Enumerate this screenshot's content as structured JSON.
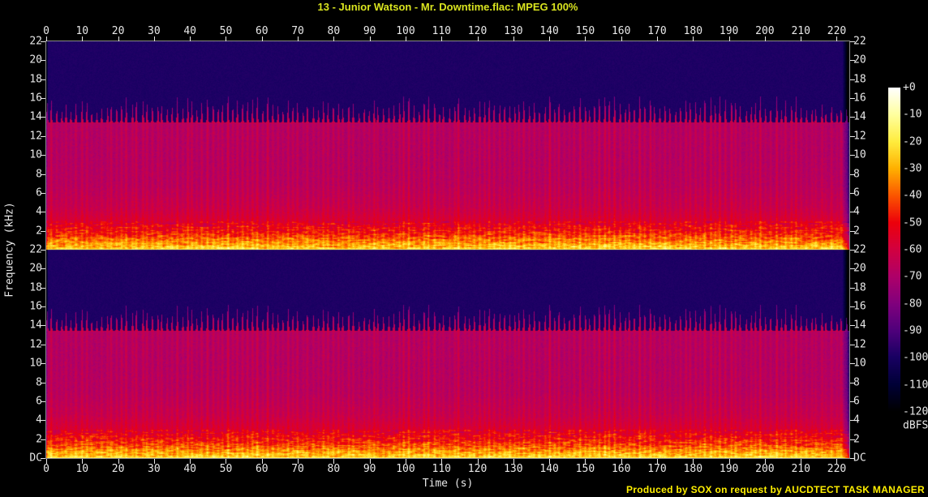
{
  "header": {
    "title": "13 - Junior Watson - Mr. Downtime.flac: MPEG 100%",
    "title_color": "#d9e41f"
  },
  "footer": {
    "credit": "Produced by SOX on request by AUCDTECT TASK MANAGER",
    "color": "#ffef00"
  },
  "ui": {
    "background": "#000000",
    "axis_text_color": "#e8e8e8",
    "plot_border_color": "#8a8a8a"
  },
  "chart_data": {
    "type": "heatmap",
    "subtype": "stereo-audio-spectrogram",
    "title": "13 - Junior Watson - Mr. Downtime.flac: MPEG 100%",
    "xlabel": "Time (s)",
    "ylabel": "Frequency (kHz)",
    "duration_s": 223.5,
    "x_ticks": [
      0,
      10,
      20,
      30,
      40,
      50,
      60,
      70,
      80,
      90,
      100,
      110,
      120,
      130,
      140,
      150,
      160,
      170,
      180,
      190,
      200,
      210,
      220
    ],
    "channels": [
      "channel-1",
      "channel-2"
    ],
    "y_ticks_khz": [
      22,
      20,
      18,
      16,
      14,
      12,
      10,
      8,
      6,
      4,
      2
    ],
    "y_bottom_label": "DC",
    "freq_range_khz": [
      0,
      22
    ],
    "grid": false,
    "legend_position": "right-colorbar",
    "colorbar": {
      "label": "dBFS",
      "ticks": [
        "+0",
        "-10",
        "-20",
        "-30",
        "-40",
        "-50",
        "-60",
        "-70",
        "-80",
        "-90",
        "-100",
        "-110",
        "-120"
      ],
      "range_db": [
        0,
        -120
      ],
      "palette_stops": [
        {
          "db": 0,
          "color": "#ffffff"
        },
        {
          "db": -10,
          "color": "#ffff9e"
        },
        {
          "db": -20,
          "color": "#ffec3e"
        },
        {
          "db": -30,
          "color": "#ffb000"
        },
        {
          "db": -40,
          "color": "#fb5500"
        },
        {
          "db": -50,
          "color": "#ec000b"
        },
        {
          "db": -60,
          "color": "#d20040"
        },
        {
          "db": -70,
          "color": "#ae0069"
        },
        {
          "db": -80,
          "color": "#81007d"
        },
        {
          "db": -90,
          "color": "#4f007b"
        },
        {
          "db": -100,
          "color": "#180062"
        },
        {
          "db": -110,
          "color": "#000036"
        },
        {
          "db": -120,
          "color": "#000000"
        }
      ]
    },
    "spectral_features": {
      "lowpass_cutoff_khz": 13.4,
      "transient_spikes_to_khz": 16.2,
      "beat_period_s": 1.4,
      "background_db": -99,
      "dc_line_db": -17,
      "band_profile_db": [
        {
          "khz": 0,
          "db": -26
        },
        {
          "khz": 0.6,
          "db": -34
        },
        {
          "khz": 1.2,
          "db": -43
        },
        {
          "khz": 2,
          "db": -52
        },
        {
          "khz": 3,
          "db": -59
        },
        {
          "khz": 4.5,
          "db": -65
        },
        {
          "khz": 7,
          "db": -69
        },
        {
          "khz": 10,
          "db": -70
        },
        {
          "khz": 13.35,
          "db": -70
        }
      ]
    }
  }
}
